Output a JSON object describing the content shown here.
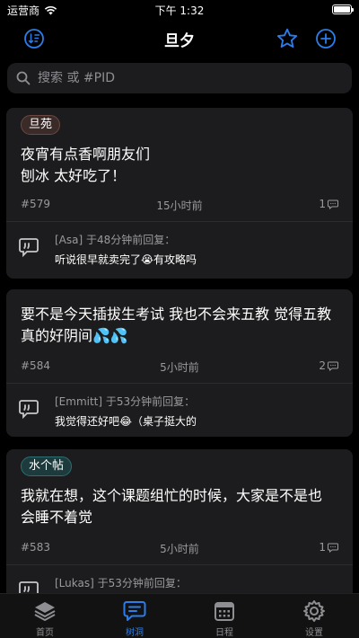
{
  "status_bar": {
    "carrier": "运营商",
    "time": "下午 1:32",
    "battery_level": 1.0
  },
  "nav": {
    "title": "旦夕"
  },
  "colors": {
    "accent": "#2b7de9",
    "tag_danyuan_bg": "#3a2b29",
    "tag_danyuan_border": "#6b4840",
    "tag_shuige_bg": "#1d3a3d",
    "tag_shuige_border": "#2b6f72"
  },
  "search": {
    "placeholder": "搜索 或 #PID"
  },
  "posts": [
    {
      "tag": "旦苑",
      "content_line1": "夜宵有点香啊朋友们",
      "content_line2": "刨冰 太好吃了！",
      "pid": "#579",
      "time": "15小时前",
      "reply_count": "1",
      "reply": {
        "author": "[Asa] 于48分钟前回复：",
        "text": "听说很早就卖完了😭有攻略吗"
      }
    },
    {
      "tag": "",
      "content_line1": "要不是今天插拔生考试 我也不会来五教 觉得五教",
      "content_line2": "真的好阴间💦💦",
      "pid": "#584",
      "time": "5小时前",
      "reply_count": "2",
      "reply": {
        "author": "[Emmitt] 于53分钟前回复：",
        "text": "我觉得还好吧😂（桌子挺大的"
      }
    },
    {
      "tag": "水个帖",
      "content_line1": "我就在想，这个课题组忙的时候，大家是不是也",
      "content_line2": "会睡不着觉",
      "pid": "#583",
      "time": "5小时前",
      "reply_count": "1",
      "reply": {
        "author": "[Lukas] 于53分钟前回复：",
        "text": ""
      }
    }
  ],
  "tabs": [
    {
      "label": "首页",
      "icon": "layers-icon"
    },
    {
      "label": "树洞",
      "icon": "message-icon"
    },
    {
      "label": "日程",
      "icon": "calendar-icon"
    },
    {
      "label": "设置",
      "icon": "gear-icon"
    }
  ]
}
